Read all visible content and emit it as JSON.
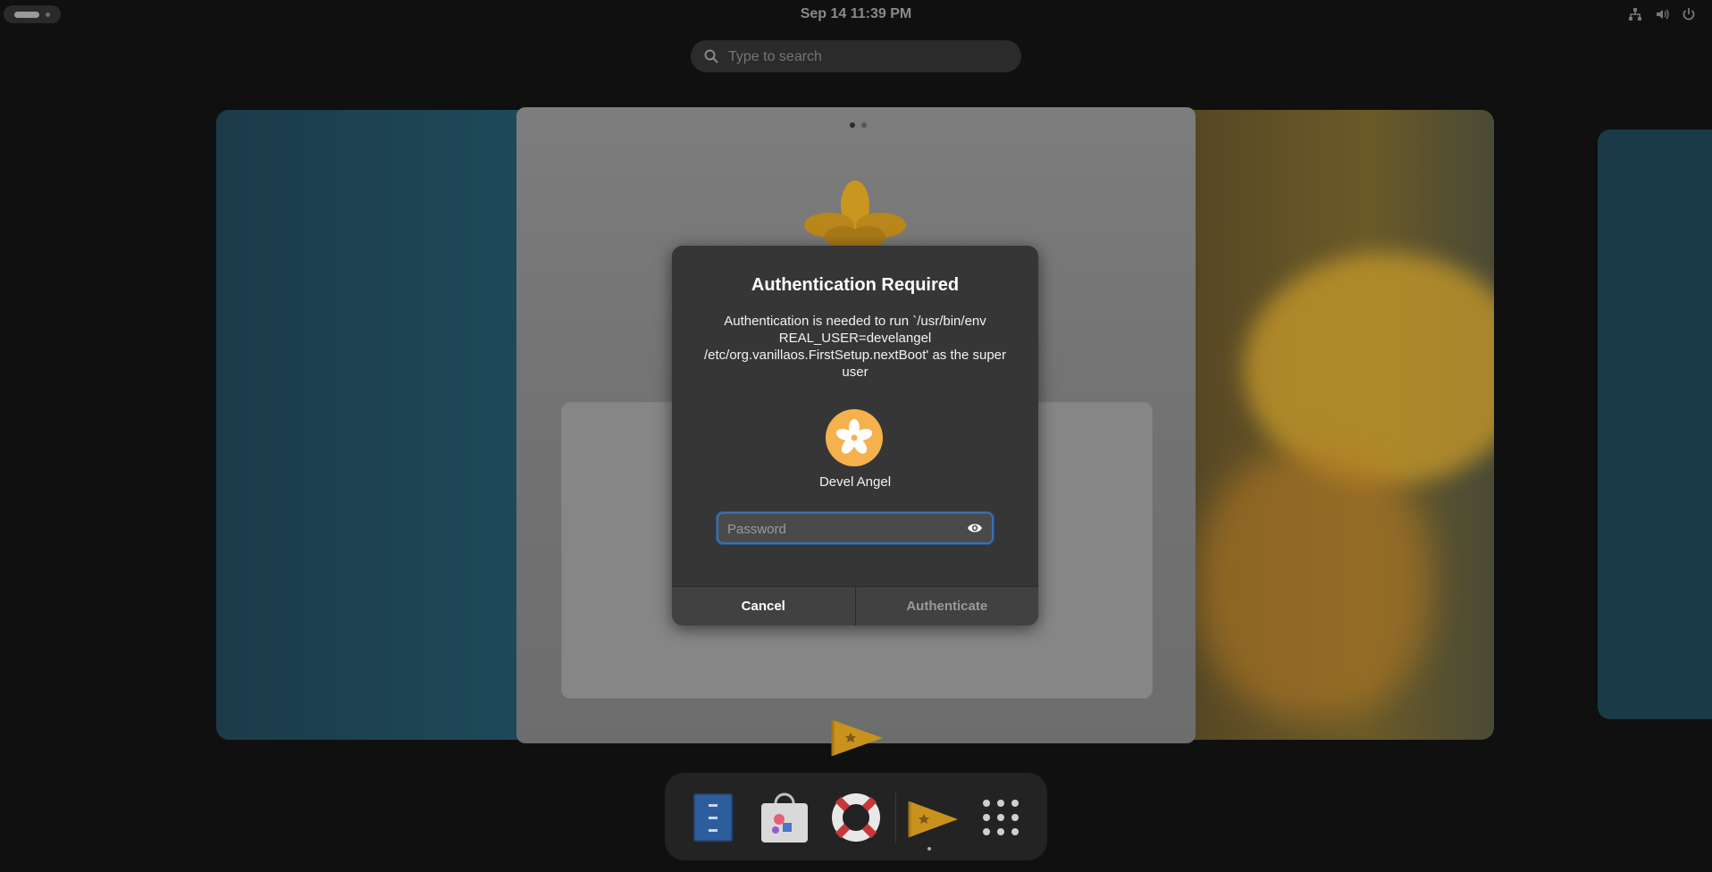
{
  "topbar": {
    "clock": "Sep 14  11:39 PM",
    "tray_icons": [
      "network-icon",
      "volume-icon",
      "power-icon"
    ]
  },
  "search": {
    "placeholder": "Type to search"
  },
  "overview": {
    "window_pages": 2,
    "active_page": 1
  },
  "dialog": {
    "title": "Authentication Required",
    "description": "Authentication is needed to run `/usr/bin/env REAL_USER=develangel /etc/org.vanillaos.FirstSetup.nextBoot' as the super user",
    "user_name": "Devel Angel",
    "password_placeholder": "Password",
    "cancel_label": "Cancel",
    "authenticate_label": "Authenticate"
  },
  "dock": {
    "apps": [
      "files-icon",
      "software-store-icon",
      "help-lifebuoy-icon",
      "vanilla-first-setup-icon",
      "app-grid-icon"
    ]
  },
  "colors": {
    "accent_focus": "#3b6fb0",
    "avatar": "#f5b14b",
    "dialog_bg": "#363636"
  }
}
